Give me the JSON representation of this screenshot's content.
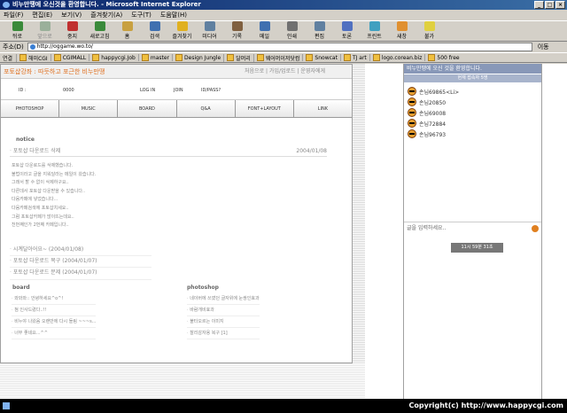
{
  "window": {
    "title": "비누만땡에 오신것을 환영합니다. - Microsoft Internet Explorer",
    "min": "_",
    "max": "□",
    "close": "×"
  },
  "menu": [
    "파일(F)",
    "편집(E)",
    "보기(V)",
    "즐겨찾기(A)",
    "도구(T)",
    "도움말(H)"
  ],
  "toolbar": [
    {
      "label": "뒤로",
      "icon": "back-icon",
      "color": "#3a8a3a",
      "disabled": false
    },
    {
      "label": "앞으로",
      "icon": "forward-icon",
      "color": "#9ab09a",
      "disabled": true
    },
    {
      "label": "중지",
      "icon": "stop-icon",
      "color": "#c03030",
      "disabled": false
    },
    {
      "label": "새로고침",
      "icon": "refresh-icon",
      "color": "#3a8a3a",
      "disabled": false
    },
    {
      "label": "홈",
      "icon": "home-icon",
      "color": "#c8a040",
      "disabled": false
    },
    {
      "label": "검색",
      "icon": "search-icon",
      "color": "#4070b0",
      "disabled": false
    },
    {
      "label": "즐겨찾기",
      "icon": "favorites-icon",
      "color": "#e0b020",
      "disabled": false
    },
    {
      "label": "미디어",
      "icon": "media-icon",
      "color": "#6080a0",
      "disabled": false
    },
    {
      "label": "기록",
      "icon": "history-icon",
      "color": "#806040",
      "disabled": false
    },
    {
      "label": "메일",
      "icon": "mail-icon",
      "color": "#4070b0",
      "disabled": false
    },
    {
      "label": "인쇄",
      "icon": "print-icon",
      "color": "#707070",
      "disabled": false
    },
    {
      "label": "편집",
      "icon": "edit-icon",
      "color": "#6080a0",
      "disabled": false
    },
    {
      "label": "토론",
      "icon": "discuss-icon",
      "color": "#5070c0",
      "disabled": false
    },
    {
      "label": "프린트",
      "icon": "printer-icon",
      "color": "#40a0c0",
      "disabled": false
    },
    {
      "label": "새창",
      "icon": "new-window-icon",
      "color": "#e09030",
      "disabled": false
    },
    {
      "label": "불가",
      "icon": "lightbulb-icon",
      "color": "#e0d040",
      "disabled": false
    }
  ],
  "address": {
    "label": "주소(D)",
    "value": "http://oggame.wo.to/",
    "go": "이동"
  },
  "links": {
    "label": "연결",
    "items": [
      "해미CGI",
      "CGIMALL",
      "happycgi.Job",
      "master",
      "Design Jungle",
      "달머리",
      "웨어머이저닷컴",
      "Snowcat",
      "TJ art",
      "logo.corean.biz",
      "500 free"
    ]
  },
  "site": {
    "logo": "포토샵강좌 : 따듯하고 포근한 비누만땡",
    "nav": "처음으로 | 가입/업로드 | 운영자에게",
    "login": {
      "id": "ID :",
      "pw": "0000",
      "login": "LOG IN",
      "join": "JOIN",
      "idpw": "ID/PASS?"
    },
    "menu": [
      "PHOTOSHOP",
      "MUSIC",
      "BOARD",
      "Q&A",
      "FONT+LAYOUT",
      "LINK"
    ],
    "notice": {
      "heading": "notice",
      "top_title": "포토샵 다운로드 삭제",
      "top_date": "2004/01/08",
      "body": [
        "포토샵 다운로드를 삭제했습니다.",
        "불법이라고 글을 지워달라는 메일이 왔습니다.",
        "그래서 할 수 없이 삭제하구요..",
        "다른데서 포토샵 다운받을 수 있습니다..",
        "다음카페에 넣었습니다...",
        "다음카페검색에 포토샵치세요..",
        "그럼 포토샵카페가 많이뜨는데요..",
        "천번째인가 2번째 카페입니다.."
      ],
      "list": [
        {
          "title": "시계달아어요~",
          "date": "(2004/01/08)"
        },
        {
          "title": "포토샵 다운로드 복구",
          "date": "(2004/01/07)"
        },
        {
          "title": "포토샵 다운로드 문제",
          "date": "(2004/01/07)"
        }
      ]
    },
    "board": {
      "heading": "board",
      "items": [
        "와와와:: 안녕하세요^o^!",
        "첨 인사드렸다..!!",
        "비누야 나왔음 오랜만에 다시 들림 ~~~s...",
        "너무 좋네요...^^"
      ]
    },
    "photoshop": {
      "heading": "photoshop",
      "items": [
        "네이버에 쓰였던 글자위에 눈쌍인효과",
        "바람개비효과",
        "불타오르는 이미지",
        "찰리감자용 복구 [1]"
      ]
    }
  },
  "chat": {
    "header": "비누만땡에 오신 것을 환영합니다.",
    "sub": "현재 접속자 5명",
    "users": [
      "손님69865<Li>",
      "손님20850",
      "손님69008",
      "손님72884",
      "손님96793"
    ],
    "input_placeholder": "글을 입력하세요..",
    "clock": "11시 59분 31초"
  },
  "status": {
    "text": "Copyright(c) http://www.happycgi.com"
  }
}
